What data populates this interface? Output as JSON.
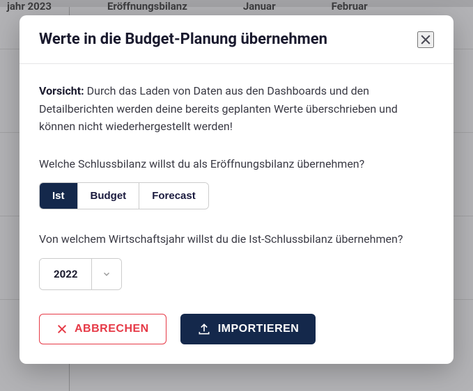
{
  "bg": {
    "year_label": "jahr 2023",
    "col1": "Eröffnungsbilanz",
    "col2": "Januar",
    "col3": "Februar"
  },
  "modal": {
    "title": "Werte in die Budget-Planung übernehmen",
    "warning_label": "Vorsicht:",
    "warning_text": " Durch das Laden von Daten aus den Dashboards und den Detailberichten werden deine bereits geplanten Werte überschrieben und können nicht wiederhergestellt werden!",
    "question1": "Welche Schlussbilanz willst du als Eröffnungsbilanz übernehmen?",
    "segments": {
      "ist": "Ist",
      "budget": "Budget",
      "forecast": "Forecast"
    },
    "question2": "Von welchem Wirtschaftsjahr willst du die Ist-Schlussbilanz übernehmen?",
    "year_selected": "2022",
    "cancel_label": "ABBRECHEN",
    "import_label": "IMPORTIEREN"
  }
}
